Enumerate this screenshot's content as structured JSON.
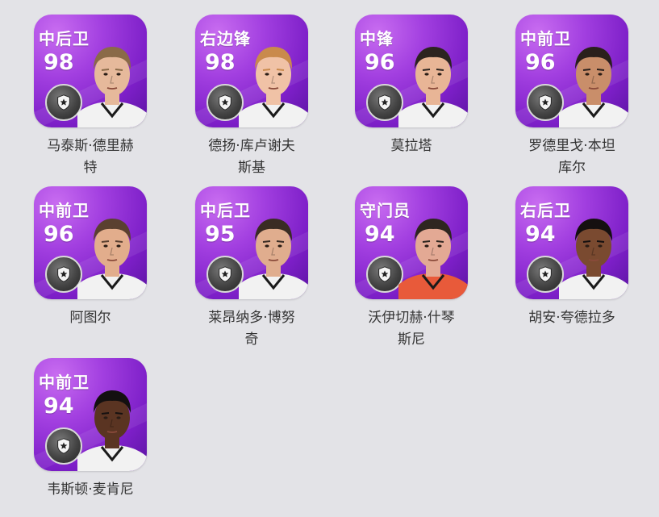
{
  "players": [
    {
      "position": "中后卫",
      "rating": "98",
      "name_line1": "马泰斯·德里赫",
      "name_line2": "特",
      "skin": "#e6b99b",
      "hair": "#8a6a48",
      "kit": "#f2f2f2"
    },
    {
      "position": "右边锋",
      "rating": "98",
      "name_line1": "德扬·库卢谢夫",
      "name_line2": "斯基",
      "skin": "#f0c2a6",
      "hair": "#c98a4c",
      "kit": "#f2f2f2"
    },
    {
      "position": "中锋",
      "rating": "96",
      "name_line1": "莫拉塔",
      "name_line2": "",
      "skin": "#e8b596",
      "hair": "#2c2420",
      "kit": "#f2f2f2"
    },
    {
      "position": "中前卫",
      "rating": "96",
      "name_line1": "罗德里戈·本坦",
      "name_line2": "库尔",
      "skin": "#c98e6a",
      "hair": "#2a201c",
      "kit": "#f2f2f2"
    },
    {
      "position": "中前卫",
      "rating": "96",
      "name_line1": "阿图尔",
      "name_line2": "",
      "skin": "#e2ad8c",
      "hair": "#5a4030",
      "kit": "#f2f2f2"
    },
    {
      "position": "中后卫",
      "rating": "95",
      "name_line1": "莱昂纳多·博努",
      "name_line2": "奇",
      "skin": "#e0ad8e",
      "hair": "#3a2c24",
      "kit": "#f2f2f2"
    },
    {
      "position": "守门员",
      "rating": "94",
      "name_line1": "沃伊切赫·什琴",
      "name_line2": "斯尼",
      "skin": "#e3a994",
      "hair": "#2e2620",
      "kit": "#e85a3a"
    },
    {
      "position": "右后卫",
      "rating": "94",
      "name_line1": "胡安·夸德拉多",
      "name_line2": "",
      "skin": "#7a4a30",
      "hair": "#151010",
      "kit": "#f2f2f2"
    },
    {
      "position": "中前卫",
      "rating": "94",
      "name_line1": "韦斯顿·麦肯尼",
      "name_line2": "",
      "skin": "#5a3422",
      "hair": "#141010",
      "kit": "#f2f2f2"
    }
  ]
}
